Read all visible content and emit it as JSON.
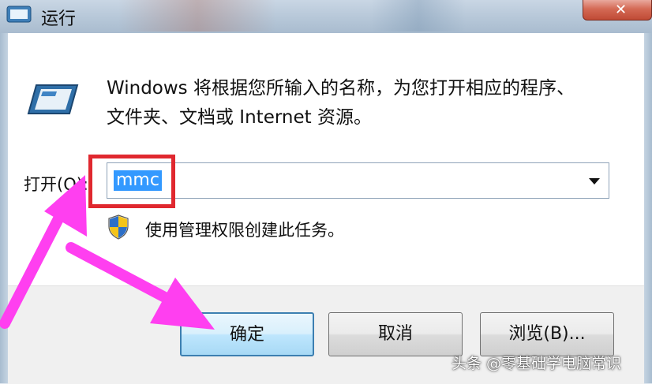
{
  "window": {
    "title": "运行",
    "close_icon": "close-icon"
  },
  "description": {
    "line1": "Windows 将根据您所输入的名称，为您打开相应的程序、",
    "line2": "文件夹、文档或 Internet 资源。"
  },
  "open": {
    "label": "打开(O):",
    "value": "mmc"
  },
  "admin_note": "使用管理权限创建此任务。",
  "buttons": {
    "ok": "确定",
    "cancel": "取消",
    "browse": "浏览(B)..."
  },
  "watermark": "头条 @零基础学电脑常识",
  "colors": {
    "highlight_box": "#e0282f",
    "arrow": "#ff3ff0",
    "selection": "#3399ff"
  },
  "icons": [
    "run-icon",
    "shield-icon",
    "dropdown-arrow-icon",
    "close-icon"
  ]
}
